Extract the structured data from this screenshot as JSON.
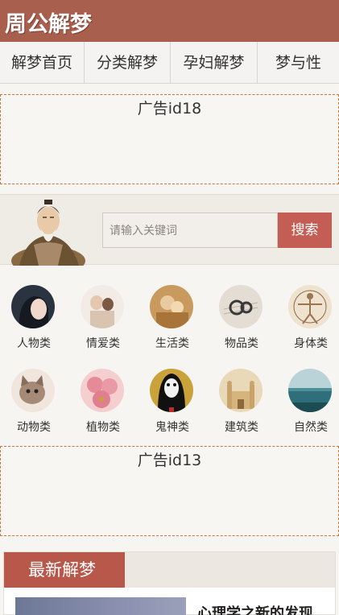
{
  "header": {
    "logo": "周公解梦"
  },
  "nav": {
    "items": [
      "解梦首页",
      "分类解梦",
      "孕妇解梦",
      "梦与性"
    ]
  },
  "ads": {
    "top": "广告id18",
    "middle": "广告id13"
  },
  "search": {
    "placeholder": "请输入关键词",
    "button": "搜索"
  },
  "categories": [
    {
      "label": "人物类",
      "icon": "woman-portrait-icon"
    },
    {
      "label": "情爱类",
      "icon": "couple-icon"
    },
    {
      "label": "生活类",
      "icon": "family-icon"
    },
    {
      "label": "物品类",
      "icon": "headphones-icon"
    },
    {
      "label": "身体类",
      "icon": "vitruvian-man-icon"
    },
    {
      "label": "动物类",
      "icon": "cat-icon"
    },
    {
      "label": "植物类",
      "icon": "flower-icon"
    },
    {
      "label": "鬼神类",
      "icon": "ghost-mask-icon"
    },
    {
      "label": "建筑类",
      "icon": "building-icon"
    },
    {
      "label": "自然类",
      "icon": "landscape-icon"
    }
  ],
  "latest": {
    "tab": "最新解梦",
    "first_title": "心理学之新的发现"
  },
  "colors": {
    "brand": "#a85f4e",
    "accent": "#c45e55",
    "ad_border": "#c8783e"
  }
}
